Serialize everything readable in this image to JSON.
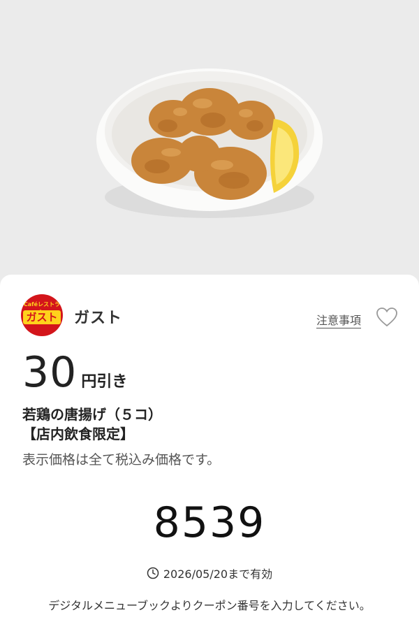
{
  "hero": {
    "image_icon": "fried-chicken-bowl-photo"
  },
  "brand": {
    "logo_top": "Caféレストラン",
    "logo_main": "ガスト",
    "name": "ガスト"
  },
  "header": {
    "notes_label": "注意事項",
    "favorite_icon": "heart-icon"
  },
  "coupon": {
    "discount_amount": "30",
    "discount_unit": "円引き",
    "item_name": "若鶏の唐揚げ（５コ）",
    "item_limit": "【店内飲食限定】",
    "tax_note": "表示価格は全て税込み価格です。",
    "code": "8539",
    "validity": "2026/05/20まで有効",
    "instruction": "デジタルメニューブックよりクーポン番号を入力してください。"
  },
  "colors": {
    "brand_red": "#d3151b",
    "brand_yellow": "#ffd21c"
  }
}
